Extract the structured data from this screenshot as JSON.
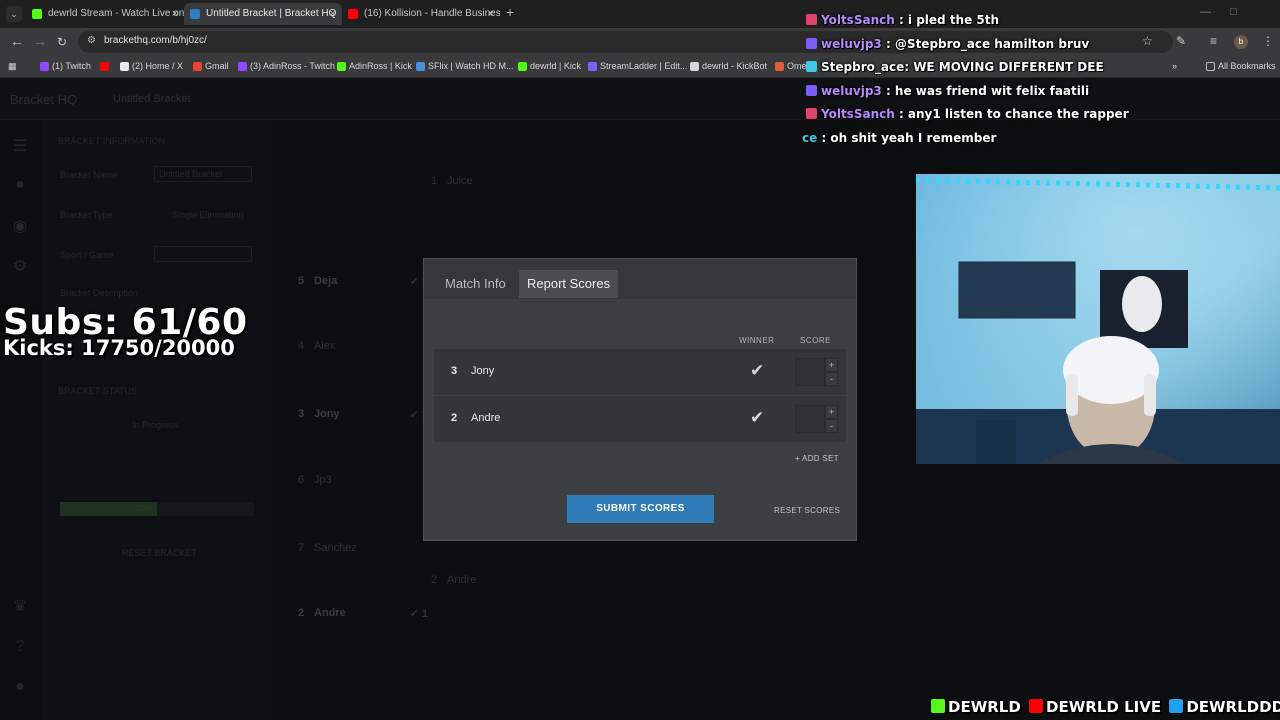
{
  "browser": {
    "tabs": [
      {
        "title": "dewrld Stream - Watch Live on",
        "favicon_color": "#53fc18",
        "active": false
      },
      {
        "title": "Untitled Bracket | Bracket HQ",
        "favicon_color": "#2f7fbf",
        "active": true
      },
      {
        "title": "(16) Kollision - Handle Business",
        "favicon_color": "#ff0000",
        "active": false
      }
    ],
    "tab_menu_glyph": "⌄",
    "new_tab": "+",
    "close_glyph": "×",
    "url": "brackethq.com/b/hj0zc/",
    "profile_initial": "b",
    "bookmarks": [
      {
        "label": "(1) Twitch",
        "color": "#9146ff"
      },
      {
        "label": "",
        "color": "#ff0000"
      },
      {
        "label": "(2) Home / X",
        "color": "#e7e9ea"
      },
      {
        "label": "Gmail",
        "color": "#ea4335"
      },
      {
        "label": "(3) AdinRoss - Twitch",
        "color": "#9146ff"
      },
      {
        "label": "AdinRoss | Kick",
        "color": "#53fc18"
      },
      {
        "label": "SFlix | Watch HD M...",
        "color": "#4a90d9"
      },
      {
        "label": "dewrld | Kick",
        "color": "#53fc18"
      },
      {
        "label": "StreamLadder | Edit...",
        "color": "#7b61ff"
      },
      {
        "label": "dewrld - KickBot",
        "color": "#d7d7d7"
      },
      {
        "label": "Ome",
        "color": "#e05a3a"
      }
    ],
    "all_bookmarks": "All Bookmarks"
  },
  "app": {
    "brand": "Bracket HQ",
    "title": "Untitled Bracket",
    "sidebar": {
      "section_info": "BRACKET INFORMATION",
      "name_label": "Bracket Name",
      "name_value": "Untitled Bracket",
      "type_label": "Bracket Type",
      "type_value": "Single Elimination",
      "sport_label": "Sport / Game",
      "desc_label": "Bracket Description",
      "section_status": "BRACKET STATUS",
      "status_value": "In Progress",
      "progress_pct": 50,
      "progress_text": "50%",
      "reset_label": "RESET BRACKET"
    },
    "bracket": {
      "round1": [
        {
          "seed": "5",
          "name": "Deja",
          "winner": true
        },
        {
          "seed": "4",
          "name": "Alex",
          "winner": false
        },
        {
          "seed": "3",
          "name": "Jony",
          "winner": true
        },
        {
          "seed": "6",
          "name": "Jp3",
          "winner": false
        },
        {
          "seed": "7",
          "name": "Sanchez",
          "winner": false
        },
        {
          "seed": "2",
          "name": "Andre",
          "winner": true
        }
      ],
      "round2": [
        {
          "seed": "1",
          "name": "Juice"
        },
        {
          "seed": "2",
          "name": "Andre"
        }
      ],
      "win_mark": "✓ 1"
    }
  },
  "modal": {
    "tabs": {
      "match_info": "Match Info",
      "report_scores": "Report Scores"
    },
    "col_winner": "WINNER",
    "col_score": "SCORE",
    "rows": [
      {
        "seed": "3",
        "name": "Jony",
        "score": ""
      },
      {
        "seed": "2",
        "name": "Andre",
        "score": ""
      }
    ],
    "plus": "+",
    "minus": "-",
    "check": "✔",
    "add_set": "+ ADD SET",
    "submit": "SUBMIT SCORES",
    "reset": "RESET SCORES"
  },
  "overlay": {
    "subs": "Subs: 61/60",
    "kicks": "Kicks: 17750/20000",
    "chat": [
      {
        "user": "YoltsSanch",
        "user_color": "#b48cff",
        "badge": "#e0446a",
        "msg": " : i pled the 5th"
      },
      {
        "user": "weluvjp3",
        "user_color": "#b48cff",
        "badge": "#7a5cff",
        "msg": " : @Stepbro_ace hamilton bruv"
      },
      {
        "user": "Stepbro_ace",
        "user_color": "#ffffff",
        "badge": "#3ec9e6",
        "msg": ": WE MOVING DIFFERENT DEE"
      },
      {
        "user": "weluvjp3",
        "user_color": "#b48cff",
        "badge": "#7a5cff",
        "msg": " : he was friend wit felix faatili"
      },
      {
        "user": "YoltsSanch",
        "user_color": "#b48cff",
        "badge": "#e0446a",
        "msg": " : any1 listen to chance the rapper"
      },
      {
        "user": "ce",
        "user_color": "#3ec9e6",
        "badge": "",
        "msg": " : oh shit yeah I remember"
      }
    ],
    "socials": [
      {
        "label": "DEWRLD",
        "icon": "kick-icon",
        "color": "#53fc18"
      },
      {
        "label": "DEWRLD LIVE",
        "icon": "youtube-icon",
        "color": "#ff0000"
      },
      {
        "label": "DEWRLDDD",
        "icon": "twitter-icon",
        "color": "#1da1f2"
      }
    ]
  }
}
